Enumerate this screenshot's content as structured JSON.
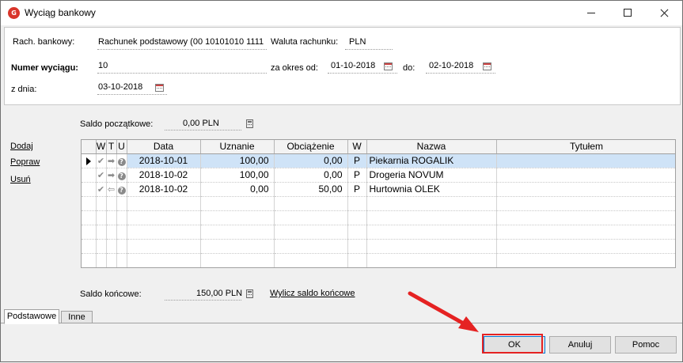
{
  "window": {
    "title": "Wyciąg bankowy",
    "icon": "app-logo-icon",
    "controls": [
      "minimize-icon",
      "maximize-icon",
      "close-icon"
    ]
  },
  "header": {
    "account_label": "Rach. bankowy:",
    "account_value": "Rachunek podstawowy (00 10101010 1111",
    "currency_label": "Waluta rachunku:",
    "currency_value": "PLN",
    "statement_no_label": "Numer wyciągu:",
    "statement_no_value": "10",
    "period_from_label": "za okres od:",
    "period_from_value": "01-10-2018",
    "period_to_label": "do:",
    "period_to_value": "02-10-2018",
    "date_label": "z dnia:",
    "date_value": "03-10-2018"
  },
  "balances": {
    "opening_label": "Saldo początkowe:",
    "opening_value": "0,00 PLN",
    "closing_label": "Saldo końcowe:",
    "closing_value": "150,00 PLN",
    "compute_link": "Wylicz saldo końcowe"
  },
  "actions": {
    "add": "Dodaj",
    "edit": "Popraw",
    "delete": "Usuń"
  },
  "grid": {
    "columns": [
      "W",
      "T",
      "U",
      "Data",
      "Uznanie",
      "Obciążenie",
      "W",
      "Nazwa",
      "Tytułem"
    ],
    "rows": [
      {
        "selected": true,
        "date": "2018-10-01",
        "credit": "100,00",
        "debit": "0,00",
        "w": "P",
        "name": "Piekarnia ROGALIK",
        "title": "",
        "t_icon": "arrow-right-icon"
      },
      {
        "selected": false,
        "date": "2018-10-02",
        "credit": "100,00",
        "debit": "0,00",
        "w": "P",
        "name": "Drogeria NOVUM",
        "title": "",
        "t_icon": "arrow-right-icon"
      },
      {
        "selected": false,
        "date": "2018-10-02",
        "credit": "0,00",
        "debit": "50,00",
        "w": "P",
        "name": "Hurtownia OLEK",
        "title": "",
        "t_icon": "arrow-left-icon"
      }
    ],
    "empty_rows": 5
  },
  "tabs": [
    "Podstawowe",
    "Inne"
  ],
  "buttons": {
    "ok": "OK",
    "cancel": "Anuluj",
    "help": "Pomoc"
  },
  "annotation": {
    "color": "#e52222"
  }
}
